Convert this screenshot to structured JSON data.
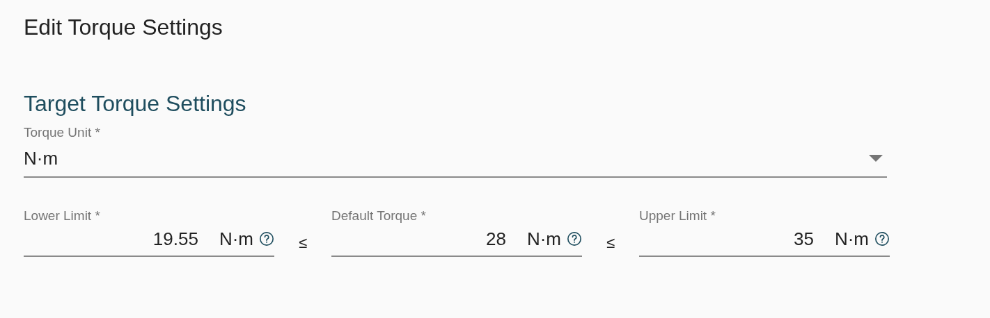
{
  "page_title": "Edit Torque Settings",
  "section_title": "Target Torque Settings",
  "torque_unit": {
    "label": "Torque Unit *",
    "value": "N·m"
  },
  "limits": [
    {
      "label": "Lower Limit *",
      "value": "19.55",
      "unit": "N·m"
    },
    {
      "label": "Default Torque *",
      "value": "28",
      "unit": "N·m"
    },
    {
      "label": "Upper Limit *",
      "value": "35",
      "unit": "N·m"
    }
  ],
  "separators": [
    "≤",
    "≤"
  ]
}
